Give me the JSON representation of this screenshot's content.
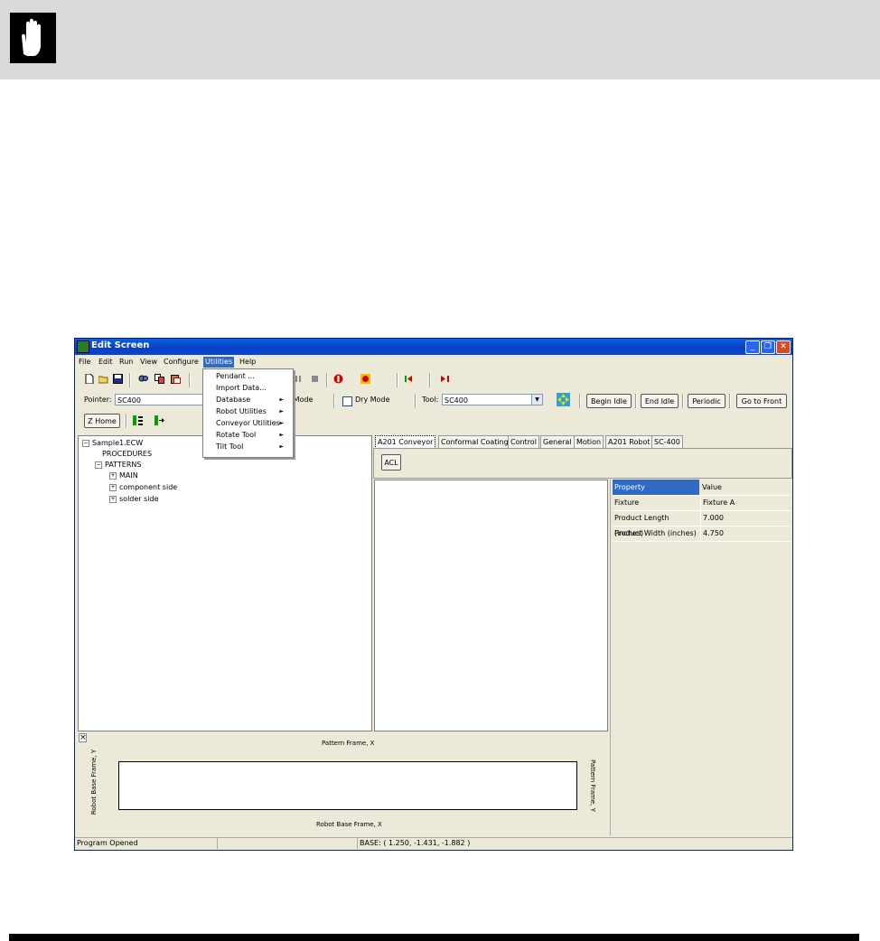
{
  "window": {
    "title": "Edit Screen"
  },
  "menu": {
    "items": [
      "File",
      "Edit",
      "Run",
      "View",
      "Configure",
      "Utilities",
      "Help"
    ],
    "active": "Utilities"
  },
  "utilities_menu": {
    "items": [
      {
        "label": "Pendant ...",
        "submenu": false
      },
      {
        "label": "Import Data...",
        "submenu": false
      },
      {
        "label": "Database",
        "submenu": true
      },
      {
        "label": "Robot Utilities",
        "submenu": true
      },
      {
        "label": "Conveyor Utilities",
        "submenu": true
      },
      {
        "label": "Rotate Tool",
        "submenu": true
      },
      {
        "label": "Tilt Tool",
        "submenu": true
      }
    ]
  },
  "toolbar": {
    "pointer_label": "Pointer:",
    "pointer_value": "SC400",
    "test_mode_label": "t Mode",
    "dry_mode_label": "Dry Mode",
    "tool_label": "Tool:",
    "tool_value": "SC400",
    "begin_idle": "Begin Idle",
    "end_idle": "End Idle",
    "periodic": "Periodic",
    "go_to_front": "Go to Front",
    "z_home": "Z Home"
  },
  "tree": {
    "root": "Sample1.ECW",
    "procedures": "PROCEDURES",
    "patterns": "PATTERNS",
    "children": [
      "MAIN",
      "component side",
      "solder side"
    ]
  },
  "tabs": {
    "items": [
      "A201 Conveyor",
      "Conformal Coating",
      "Control",
      "General",
      "Motion",
      "A201 Robot",
      "SC-400"
    ],
    "active": "A201 Conveyor",
    "acl_button": "ACL"
  },
  "properties": {
    "header": {
      "property": "Property",
      "value": "Value"
    },
    "rows": [
      {
        "property": "Fixture",
        "value": "Fixture A"
      },
      {
        "property": "Product Length (inches)",
        "value": "7.000"
      },
      {
        "property": "Product Width (inches)",
        "value": "4.750"
      }
    ]
  },
  "frame_view": {
    "top_label": "Pattern Frame, X",
    "bottom_label": "Robot Base Frame, X",
    "left_label": "Robot Base Frame, Y",
    "right_label": "Pattern Frame, Y",
    "close_glyph": "×"
  },
  "status": {
    "left": "Program Opened",
    "position": "BASE: ( 1.250, -1.431, -1.882 )"
  },
  "colors": {
    "title_bar": "#0a47d0",
    "menu_highlight": "#316ac5",
    "property_header": "#316ac5",
    "window_bg": "#ece9d8",
    "page_header": "#d9d9d9"
  }
}
